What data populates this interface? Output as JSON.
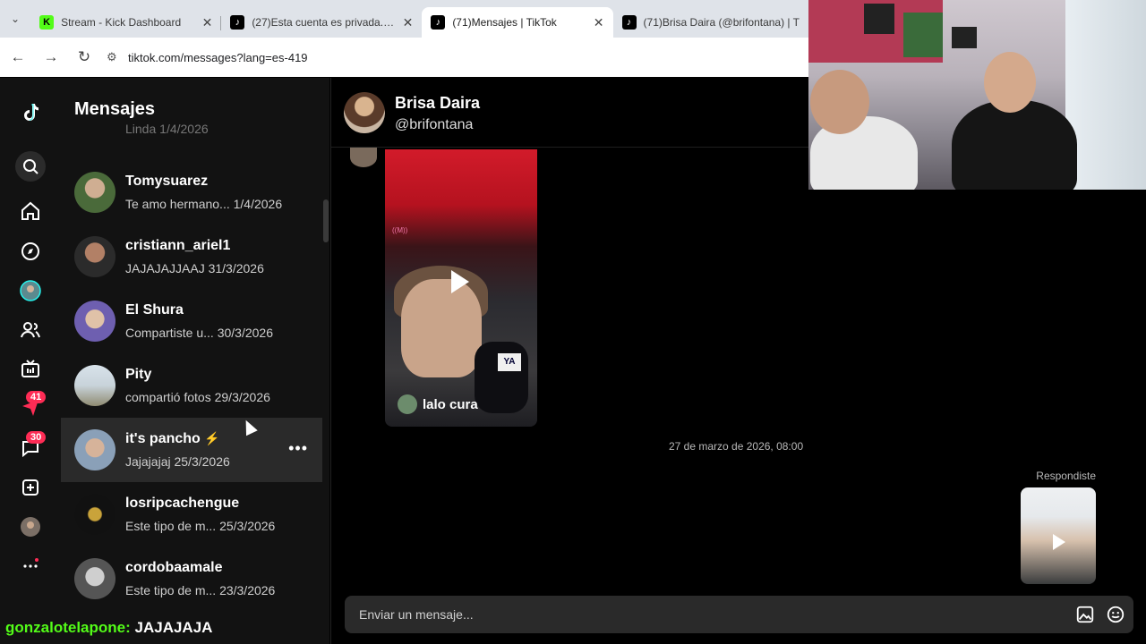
{
  "browser": {
    "tabs": [
      {
        "title": "Stream - Kick Dashboard",
        "favicon": "kick-icon",
        "active": false
      },
      {
        "title": "(27)Esta cuenta es privada. Sigu",
        "favicon": "tiktok-icon",
        "active": false
      },
      {
        "title": "(71)Mensajes | TikTok",
        "favicon": "tiktok-icon",
        "active": true
      },
      {
        "title": "(71)Brisa Daira (@brifontana) | T",
        "favicon": "tiktok-icon",
        "active": false
      }
    ],
    "url": "tiktok.com/messages?lang=es-419"
  },
  "rail": {
    "inbox_badge": "41",
    "messages_badge": "30"
  },
  "messages": {
    "heading": "Mensajes",
    "conversations": [
      {
        "name": "Tomysuarez",
        "preview": "Te amo hermano...",
        "date": "1/4/2026"
      },
      {
        "name": "cristiann_ariel1",
        "preview": "JAJAJAJJAAJ",
        "date": "31/3/2026"
      },
      {
        "name": "El Shura",
        "preview": "Compartiste u...",
        "date": "30/3/2026"
      },
      {
        "name": "Pity",
        "preview": "compartió fotos",
        "date": "29/3/2026"
      },
      {
        "name": "it's pancho",
        "preview": "Jajajajaj",
        "date": "25/3/2026",
        "selected": true
      },
      {
        "name": "losripcachengue",
        "preview": "Este tipo de m...",
        "date": "25/3/2026"
      },
      {
        "name": "cordobaamale",
        "preview": "Este tipo de m...",
        "date": "23/3/2026"
      }
    ],
    "partial_top": {
      "preview": "Linda",
      "date": "1/4/2026"
    }
  },
  "chat": {
    "contact_name": "Brisa Daira",
    "contact_handle": "@brifontana",
    "video_author": "lalo cura",
    "video_mic_tag": "YA",
    "timestamp": "27 de marzo de 2026, 08:00",
    "replied_label": "Respondiste",
    "composer_placeholder": "Enviar un mensaje..."
  },
  "stream_chat": {
    "user": "gonzalotelapone:",
    "message": "JAJAJAJA"
  },
  "colors": {
    "accent": "#fe2c55",
    "kick_green": "#53fc18"
  }
}
